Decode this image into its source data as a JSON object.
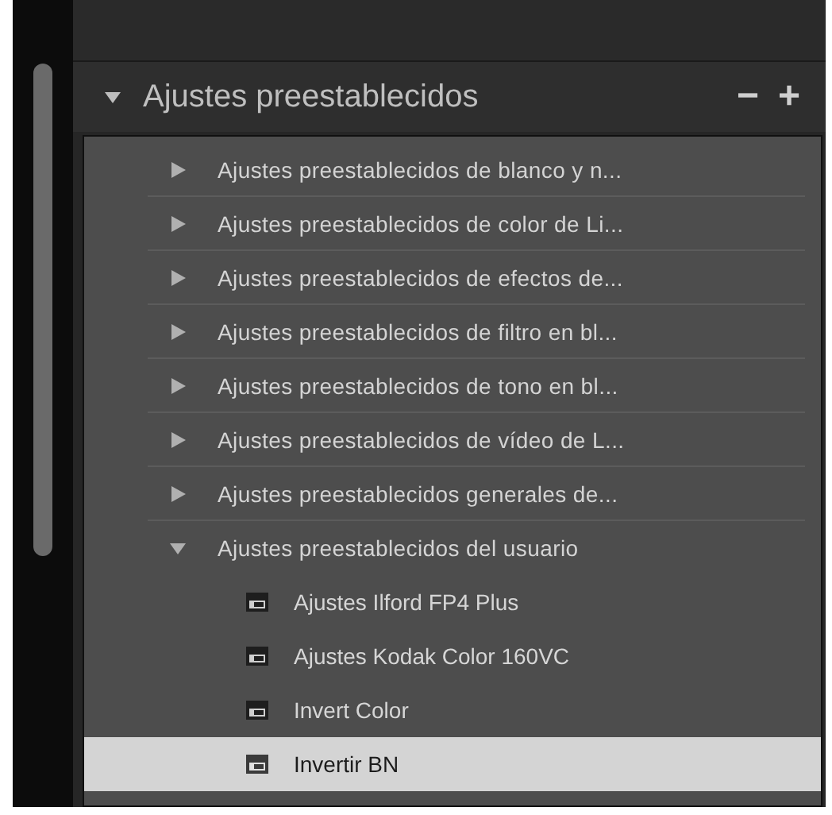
{
  "panel": {
    "title": "Ajustes preestablecidos",
    "expanded": true,
    "remove_label": "−",
    "add_label": "+"
  },
  "folders": [
    {
      "label": "Ajustes preestablecidos de blanco y n...",
      "expanded": false
    },
    {
      "label": "Ajustes preestablecidos de color de Li...",
      "expanded": false
    },
    {
      "label": "Ajustes preestablecidos de efectos de...",
      "expanded": false
    },
    {
      "label": "Ajustes preestablecidos de filtro en bl...",
      "expanded": false
    },
    {
      "label": "Ajustes preestablecidos de tono en bl...",
      "expanded": false
    },
    {
      "label": "Ajustes preestablecidos de vídeo de L...",
      "expanded": false
    },
    {
      "label": "Ajustes preestablecidos generales de...",
      "expanded": false
    },
    {
      "label": "Ajustes preestablecidos del usuario",
      "expanded": true,
      "children": [
        {
          "label": "Ajustes Ilford FP4 Plus",
          "selected": false
        },
        {
          "label": "Ajustes Kodak Color 160VC",
          "selected": false
        },
        {
          "label": "Invert Color",
          "selected": false
        },
        {
          "label": "Invertir BN",
          "selected": true
        }
      ]
    }
  ]
}
